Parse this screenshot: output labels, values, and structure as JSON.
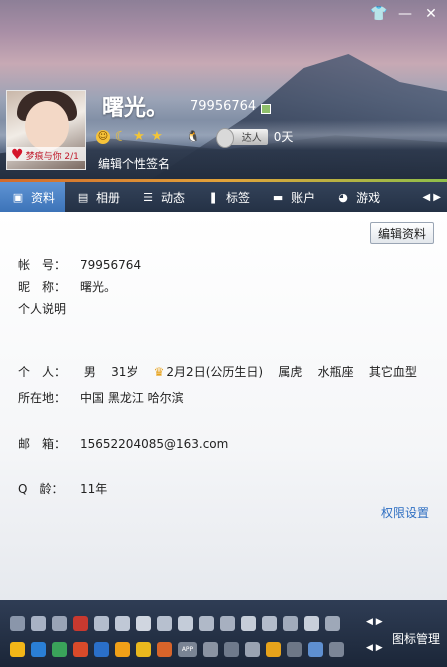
{
  "window": {
    "controls": [
      "skin-icon",
      "minimize-icon",
      "close-icon"
    ]
  },
  "profile": {
    "nickname": "曙光。",
    "qq_number": "79956764",
    "avatar_tag": "梦痕与你 2/1",
    "daren_label": "达人",
    "daren_days": "0天",
    "signature_placeholder": "编辑个性签名"
  },
  "tabs": [
    {
      "label": "资料",
      "icon": "profile-card-icon",
      "active": true
    },
    {
      "label": "相册",
      "icon": "photo-album-icon",
      "active": false
    },
    {
      "label": "动态",
      "icon": "feed-list-icon",
      "active": false
    },
    {
      "label": "标签",
      "icon": "bookmark-icon",
      "active": false
    },
    {
      "label": "账户",
      "icon": "wallet-icon",
      "active": false
    },
    {
      "label": "游戏",
      "icon": "game-icon",
      "active": false
    }
  ],
  "details": {
    "edit_button": "编辑资料",
    "account_label": "帐　号：",
    "account_value": "79956764",
    "nick_label": "昵　称：",
    "nick_value": "曙光。",
    "desc_label": "个人说明",
    "personal_label": "个　人：",
    "gender": "男",
    "age": "31岁",
    "birthday": "2月2日(公历生日)",
    "zodiac": "属虎",
    "constellation": "水瓶座",
    "blood_type": "其它血型",
    "location_label": "所在地：",
    "location_value": "中国 黑龙江 哈尔滨",
    "email_label": "邮　箱：",
    "email_value": "15652204085@163.com",
    "qage_label": "Q　龄：",
    "qage_value": "11年",
    "permission_link": "权限设置"
  },
  "appbar": {
    "manage_label": "图标管理",
    "app": "APP",
    "colors": {
      "top_row": [
        "#8a96aa",
        "#a8b2c4",
        "#9aa4b6",
        "#c9392f",
        "#b3bdcd",
        "#c0c8d6",
        "#d0d6e0",
        "#b7c0cf",
        "#c4ccd9",
        "#b0b9c8",
        "#a7b0c0",
        "#c6cdd8",
        "#b3bccb",
        "#a1abbb",
        "#c8cfda",
        "#9ea8b8"
      ],
      "bottom_row": [
        "#f2b618",
        "#2a7fd6",
        "#3aa35a",
        "#d94a2a",
        "#2a6fc9",
        "#f0a018",
        "#e9b81e",
        "#d8642a",
        "#7a8494",
        "#8a93a2",
        "#6f7a8c",
        "#9aa3b2",
        "#e7a31b",
        "#6d7787",
        "#5e8fd0",
        "#7b8596"
      ]
    }
  }
}
